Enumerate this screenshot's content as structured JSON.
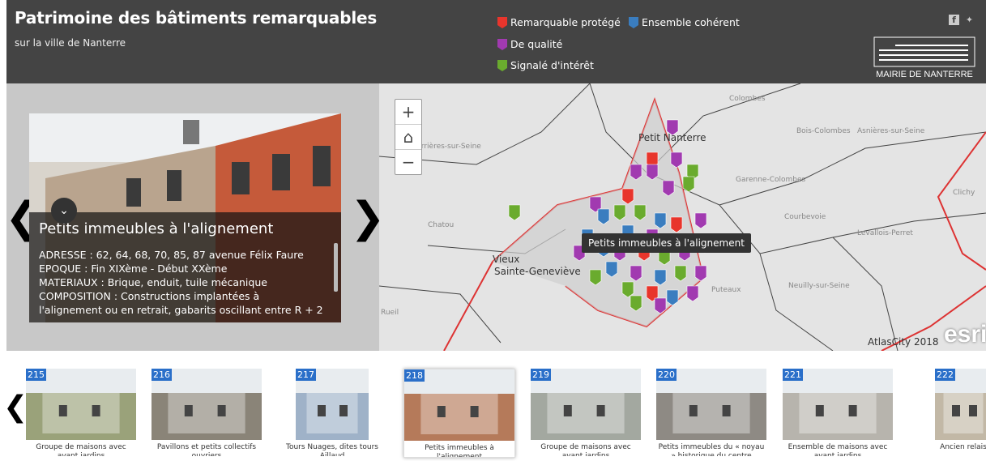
{
  "header": {
    "title": "Patrimoine des bâtiments remarquables",
    "subtitle": "sur la ville de Nanterre",
    "legend": [
      {
        "label": "Remarquable protégé",
        "color": "#e8352c"
      },
      {
        "label": "Ensemble cohérent",
        "color": "#3a7dbf"
      },
      {
        "label": "De qualité",
        "color": "#a13ab0"
      },
      {
        "label": "Signalé d'intérêt",
        "color": "#6aab2e"
      }
    ],
    "social": [
      "facebook-icon",
      "twitter-icon"
    ],
    "logo_text": "MAIRIE DE NANTERRE"
  },
  "detail": {
    "title": "Petits immeubles à l'alignement",
    "lines": [
      "ADRESSE : 62, 64, 68, 70, 85, 87 avenue Félix Faure",
      "EPOQUE : Fin XIXème - Début XXème",
      "MATERIAUX : Brique, enduit, tuile mécanique",
      "COMPOSITION : Constructions implantées à",
      "l'alignement ou en retrait, gabarits oscillant entre R + 2"
    ]
  },
  "map": {
    "tooltip": "Petits immeubles à l'alignement",
    "credit": "AtlasCity 2018",
    "esri": "esri",
    "places": [
      "Colombes",
      "Bois-Colombes",
      "Asnières-sur-Seine",
      "Carrières-sur-Seine",
      "Petit Nanterre",
      "Clichy",
      "Chatou",
      "Courbevoie",
      "Levallois-Perret",
      "Vieux",
      "Sainte-Geneviève",
      "Puteaux",
      "Neuilly-sur-Seine",
      "Garenne-Colombes",
      "Rueil"
    ],
    "zoom_in": "+",
    "zoom_out": "−"
  },
  "thumbs": [
    {
      "num": "215",
      "caption": "Groupe de maisons avec avant jardins"
    },
    {
      "num": "216",
      "caption": "Pavillons et petits collectifs ouvriers"
    },
    {
      "num": "217",
      "caption": "Tours Nuages, dites tours Aillaud"
    },
    {
      "num": "218",
      "caption": "Petits immeubles à l'alignement"
    },
    {
      "num": "219",
      "caption": "Groupe de maisons avec avant jardins"
    },
    {
      "num": "220",
      "caption": "Petits immeubles du « noyau » historique du centre"
    },
    {
      "num": "221",
      "caption": "Ensemble de maisons avec avant jardins"
    },
    {
      "num": "222",
      "caption": "Ancien relais"
    }
  ],
  "nav": {
    "prev": "❮",
    "next": "❯"
  }
}
